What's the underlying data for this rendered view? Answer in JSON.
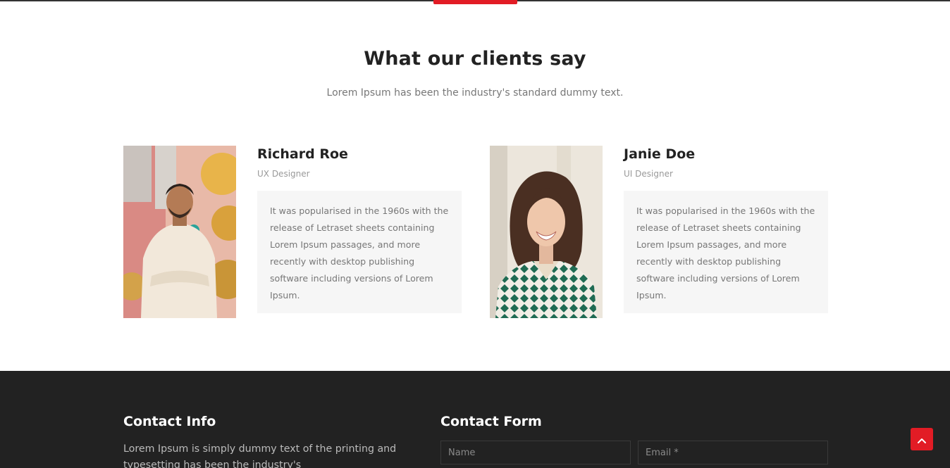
{
  "testimonials_section": {
    "title": "What our clients say",
    "subtitle": "Lorem Ipsum has been the industry's standard dummy text."
  },
  "testimonials": [
    {
      "name": "Richard Roe",
      "role": "UX Designer",
      "quote": "It was popularised in the 1960s with the release of Letraset sheets containing Lorem Ipsum passages, and more recently with desktop publishing software including versions of Lorem Ipsum."
    },
    {
      "name": "Janie Doe",
      "role": "UI Designer",
      "quote": "It was popularised in the 1960s with the release of Letraset sheets containing Lorem Ipsum passages, and more recently with desktop publishing software including versions of Lorem Ipsum."
    }
  ],
  "footer": {
    "contact_info": {
      "heading": "Contact Info",
      "text": "Lorem Ipsum is simply dummy text of the printing and typesetting has been the industry's"
    },
    "contact_form": {
      "heading": "Contact Form",
      "name_placeholder": "Name",
      "email_placeholder": "Email *"
    }
  },
  "colors": {
    "accent": "#e21c25",
    "footer_bg": "#222222",
    "quote_bg": "#f6f6f6"
  },
  "icons": {
    "back_to_top": "chevron-up-icon"
  }
}
